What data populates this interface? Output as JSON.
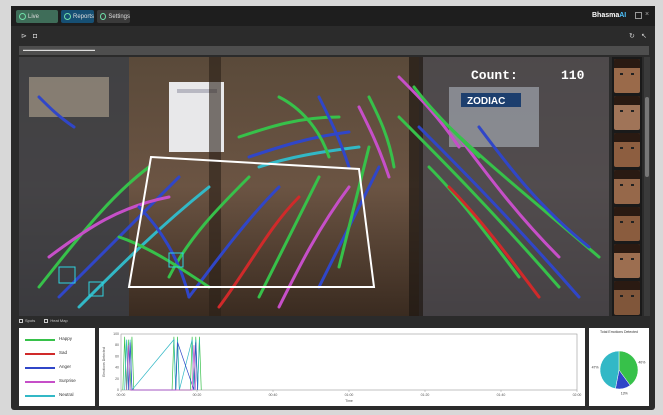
{
  "tabs": [
    {
      "label": "Live",
      "icon": "camera-icon"
    },
    {
      "label": "Reports",
      "icon": "reports-icon"
    },
    {
      "label": "Settings",
      "icon": "gear-icon"
    }
  ],
  "brand": {
    "name": "Bhasma",
    "suffix": "AI"
  },
  "video": {
    "count_label": "Count:",
    "count_value": "110",
    "store_sign": "ZODIAC"
  },
  "checkboxes": [
    {
      "label": "Spots"
    },
    {
      "label": "Heat Map"
    }
  ],
  "legend": [
    {
      "label": "Happy",
      "color": "#37c14a"
    },
    {
      "label": "Sad",
      "color": "#d02a2a"
    },
    {
      "label": "Anger",
      "color": "#3046c8"
    },
    {
      "label": "Surprise",
      "color": "#c64fc8"
    },
    {
      "label": "Neutral",
      "color": "#32b8c6"
    }
  ],
  "pie_panel": {
    "title": "Total Emotions Detected"
  },
  "chart_data": [
    {
      "type": "line",
      "title": "",
      "xlabel": "Time",
      "ylabel": "Emotions Detected",
      "ylim": [
        0,
        100
      ],
      "y_ticks": [
        "0",
        "20",
        "40",
        "60",
        "80",
        "100"
      ],
      "x_ticks": [
        "00:00",
        "00:20",
        "00:40",
        "01:00",
        "01:20",
        "01:40",
        "02:00"
      ],
      "xlim": [
        0,
        125
      ],
      "series": [
        {
          "name": "Happy",
          "x": [
            0.5,
            1,
            1.5,
            2,
            2.5,
            3,
            3.5,
            4,
            14,
            14.5,
            15,
            15.5,
            16,
            16.5,
            19,
            19.5,
            20,
            20.5,
            21,
            21.5,
            22
          ],
          "values": [
            0,
            95,
            0,
            90,
            0,
            95,
            0,
            0,
            0,
            95,
            0,
            95,
            0,
            0,
            0,
            95,
            0,
            95,
            0,
            95,
            0
          ]
        },
        {
          "name": "Neutral",
          "x": [
            1,
            1.5,
            2,
            2.5,
            3,
            14.5,
            15,
            15.5,
            16,
            19.5,
            20,
            20.5,
            21,
            21.5
          ],
          "values": [
            0,
            90,
            0,
            90,
            0,
            90,
            0,
            90,
            0,
            90,
            0,
            90,
            0,
            90
          ]
        },
        {
          "name": "Anger",
          "x": [
            2,
            2.5,
            3,
            15,
            15.5,
            20,
            20.5,
            21
          ],
          "values": [
            0,
            85,
            0,
            0,
            85,
            0,
            85,
            0
          ]
        },
        {
          "name": "Surprise",
          "x": [
            1.5,
            2,
            2.5,
            19.5,
            20,
            20.5
          ],
          "values": [
            0,
            80,
            0,
            0,
            80,
            0
          ]
        }
      ]
    },
    {
      "type": "pie",
      "categories": [
        "Happy",
        "Anger",
        "Neutral"
      ],
      "values": [
        40,
        13,
        47
      ],
      "labels": [
        "40%",
        "13%",
        "47%"
      ]
    }
  ]
}
